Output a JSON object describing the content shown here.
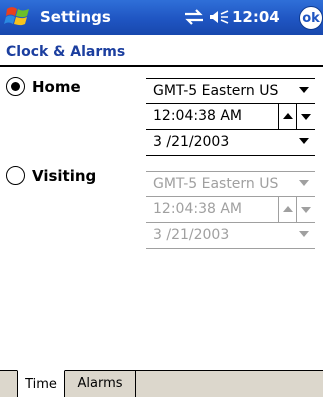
{
  "titlebar": {
    "app_title": "Settings",
    "clock": "12:04",
    "ok_label": "ok",
    "start_icon": "windows-flag-icon",
    "connectivity_icon": "connectivity-icon",
    "volume_icon": "speaker-icon",
    "bar_color": "#1f55c2"
  },
  "page": {
    "title": "Clock & Alarms",
    "title_color": "#1c3f9f"
  },
  "home": {
    "label": "Home",
    "selected": true,
    "timezone": "GMT-5 Eastern US",
    "time": "12:04:38 AM",
    "date": "3 /21/2003"
  },
  "visiting": {
    "label": "Visiting",
    "selected": false,
    "timezone": "GMT-5 Eastern US",
    "time": "12:04:38 AM",
    "date": "3 /21/2003"
  },
  "tabs": [
    {
      "label": "Time",
      "active": true
    },
    {
      "label": "Alarms",
      "active": false
    }
  ]
}
